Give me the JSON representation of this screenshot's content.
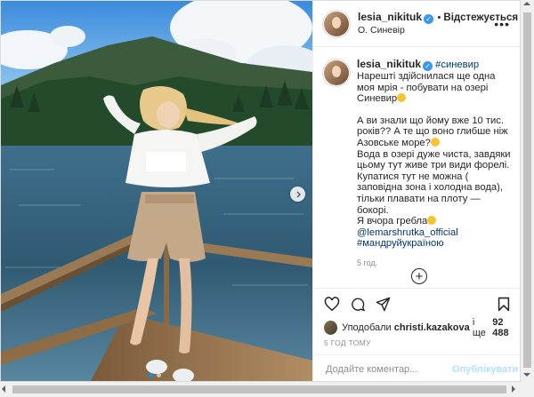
{
  "post": {
    "username": "lesia_nikituk",
    "follow_status": "Відстежується",
    "location": "О. Синевір",
    "caption": {
      "username": "lesia_nikituk",
      "hashtag_inline": "#синевир",
      "p1": "Нарешті здійснилася ще одна моя мрія - побувати на озері Синевир",
      "p2a": "А ви знали що йому вже 10 тис. років?? А те що воно глибше ніж Азовське море?",
      "p2b": "Вода в озері дуже чиста, завдяки цьому тут живе три види форелі.",
      "p2c": "Купатися тут не можна ( заповідна зона і холодна вода), тільки плавати на плоту — бокорі.",
      "p2d": "Я вчора гребла",
      "mention": "@lemarshrutka_official",
      "hashtag": "#мандруйукраїною",
      "time": "5 год."
    },
    "likes": {
      "prefix": "Уподобали",
      "user": "christi.kazakova",
      "middle": "і ще",
      "count": "92 488"
    },
    "ago": "5 ГОД ТОМУ",
    "comment_placeholder": "Додайте коментар...",
    "publish_label": "Опублікувати"
  },
  "colors": {
    "link": "#00376b",
    "verified": "#3897f0",
    "publish_disabled": "#b2dffc",
    "carousel_active": "#0095f6"
  },
  "icons": [
    "more-options-icon",
    "verified-icon",
    "heart-icon",
    "comment-icon",
    "share-icon",
    "save-icon",
    "add-comment-icon",
    "chevron-right-icon"
  ]
}
